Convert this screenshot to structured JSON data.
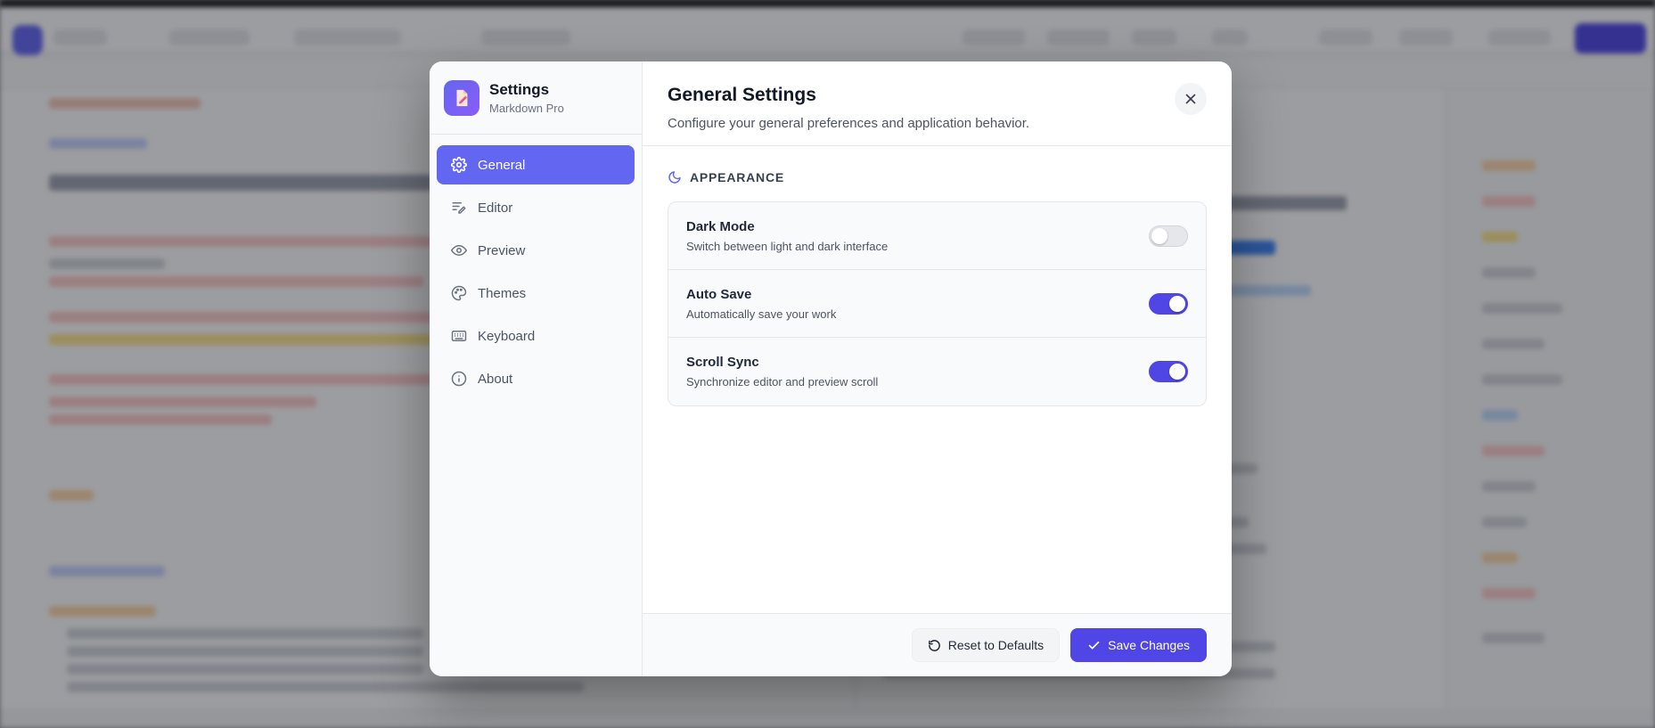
{
  "sidebar": {
    "title": "Settings",
    "subtitle": "Markdown Pro",
    "app_icon": "document-edit-icon",
    "items": [
      {
        "label": "General",
        "icon": "gear-icon",
        "active": true
      },
      {
        "label": "Editor",
        "icon": "pen-lines-icon",
        "active": false
      },
      {
        "label": "Preview",
        "icon": "eye-icon",
        "active": false
      },
      {
        "label": "Themes",
        "icon": "palette-icon",
        "active": false
      },
      {
        "label": "Keyboard",
        "icon": "keyboard-icon",
        "active": false
      },
      {
        "label": "About",
        "icon": "info-icon",
        "active": false
      }
    ]
  },
  "header": {
    "title": "General Settings",
    "description": "Configure your general preferences and application behavior.",
    "close_icon": "close-icon"
  },
  "section": {
    "label": "APPEARANCE",
    "icon": "moon-icon",
    "settings": [
      {
        "name": "Dark Mode",
        "description": "Switch between light and dark interface",
        "enabled": false
      },
      {
        "name": "Auto Save",
        "description": "Automatically save your work",
        "enabled": true
      },
      {
        "name": "Scroll Sync",
        "description": "Synchronize editor and preview scroll",
        "enabled": true
      }
    ]
  },
  "footer": {
    "reset_label": "Reset to Defaults",
    "reset_icon": "rotate-ccw-icon",
    "save_label": "Save Changes",
    "save_icon": "check-icon"
  },
  "colors": {
    "accent": "#4f46e5",
    "accent_light": "#6366f1",
    "toggle_off": "#e5e7eb"
  }
}
